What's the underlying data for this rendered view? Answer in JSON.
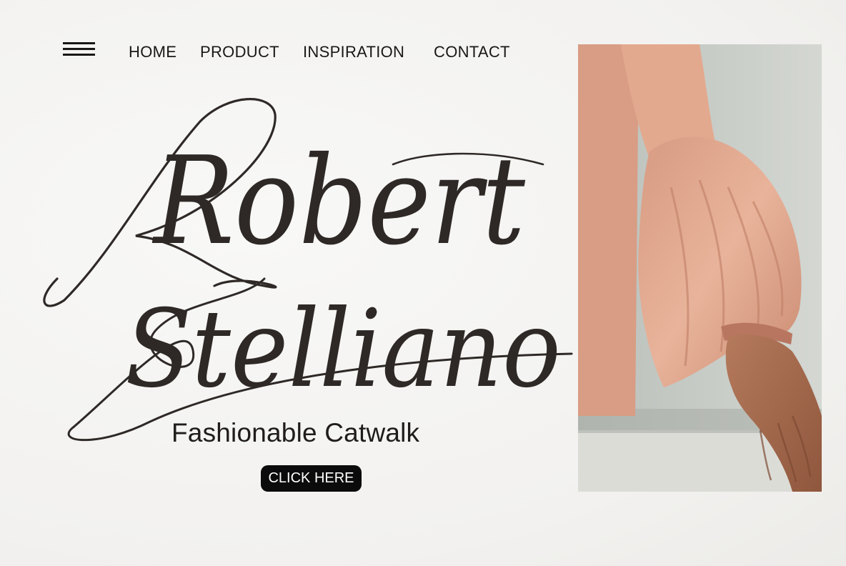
{
  "nav": {
    "menu_icon": "hamburger-icon",
    "items": [
      {
        "label": "HOME"
      },
      {
        "label": "PRODUCT"
      },
      {
        "label": "INSPIRATION"
      },
      {
        "label": "CONTACT"
      }
    ]
  },
  "hero": {
    "script_line_1": "Robert",
    "script_line_2": "Stelliano",
    "subtitle": "Fashionable Catwalk",
    "cta_label": "CLICK HERE"
  },
  "photo": {
    "subject": "fashion-model-sleeve-photo"
  },
  "colors": {
    "background": "#f4f3f1",
    "text": "#1a1816",
    "button_bg": "#0b0b0b",
    "button_text": "#ffffff",
    "fabric": "#e2a98f",
    "wall": "#c9cdc7"
  }
}
